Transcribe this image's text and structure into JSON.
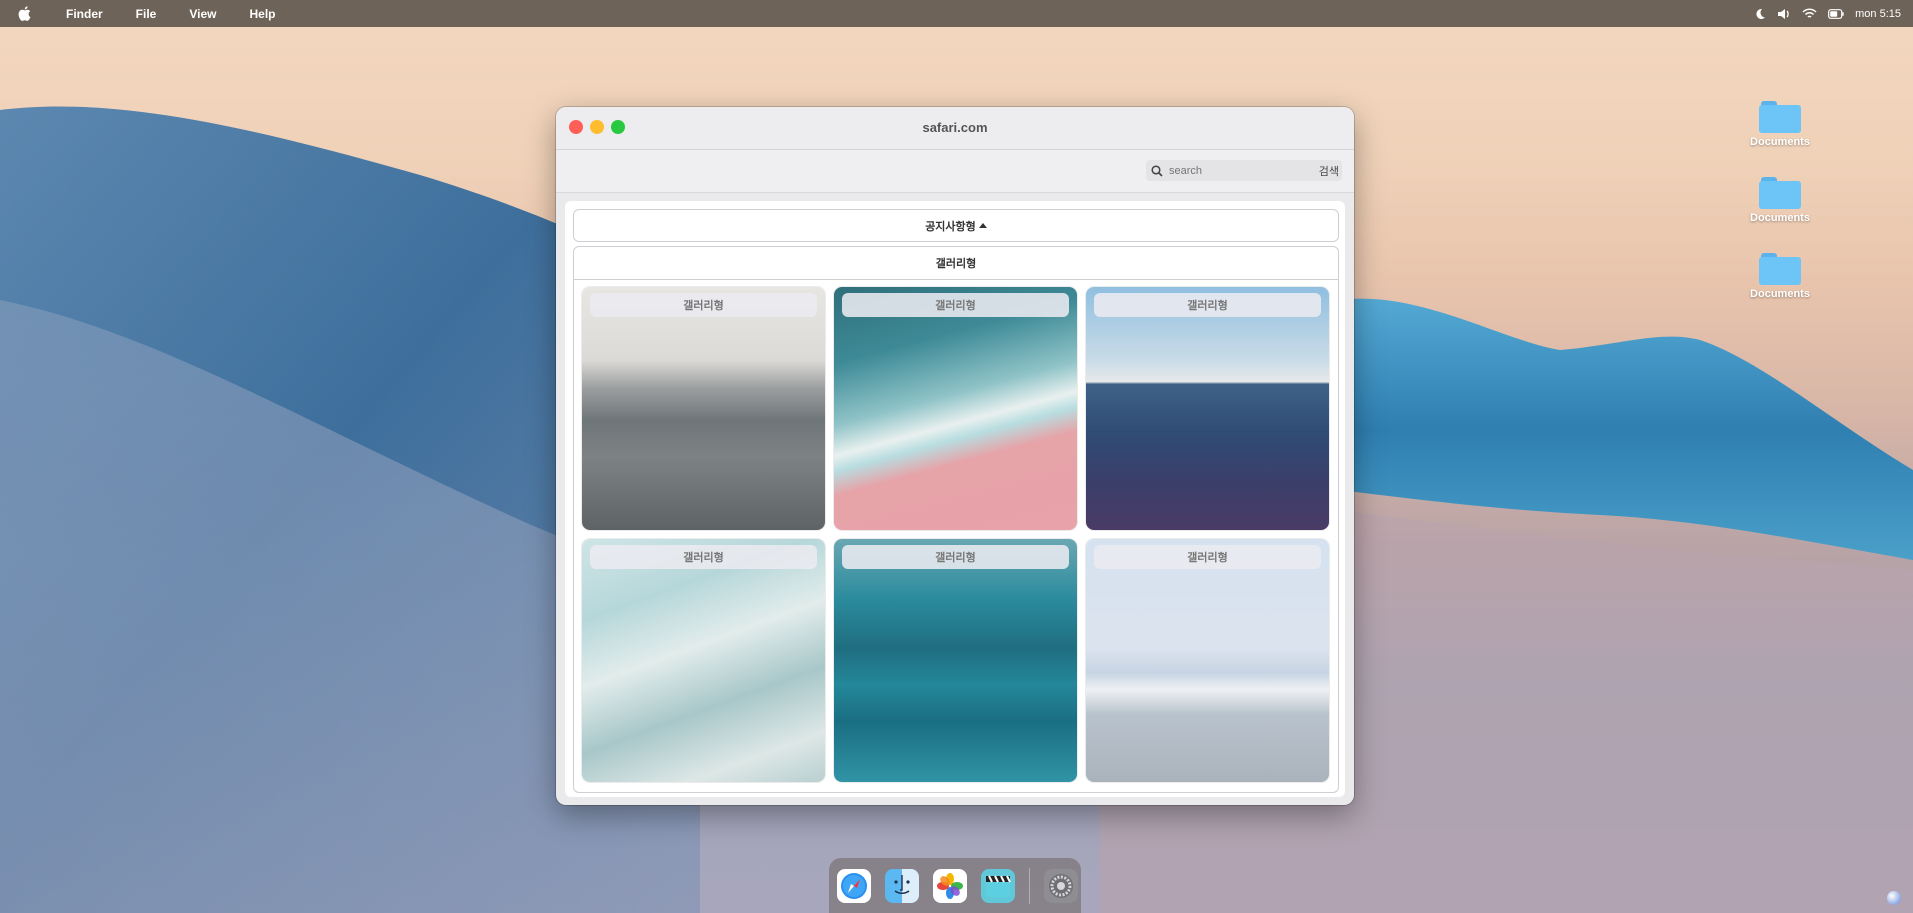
{
  "menubar": {
    "app": "Finder",
    "items": [
      "File",
      "View",
      "Help"
    ],
    "clock": "mon 5:15"
  },
  "desktop": {
    "icons": [
      {
        "label": "Documents",
        "icon": "folder-icon"
      },
      {
        "label": "Documents",
        "icon": "folder-icon"
      },
      {
        "label": "Documents",
        "icon": "folder-icon"
      }
    ]
  },
  "window": {
    "title": "safari.com",
    "search": {
      "placeholder": "search",
      "value": "",
      "button": "검색"
    },
    "notice_toggle": "공지사항형",
    "gallery": {
      "header": "갤러리형",
      "items": [
        {
          "label": "갤러리형",
          "image": "grey-sea-horizon"
        },
        {
          "label": "갤러리형",
          "image": "wave-on-pink-beach"
        },
        {
          "label": "갤러리형",
          "image": "deep-blue-sea-horizon"
        },
        {
          "label": "갤러리형",
          "image": "white-foam-water"
        },
        {
          "label": "갤러리형",
          "image": "teal-ocean-waves"
        },
        {
          "label": "갤러리형",
          "image": "misty-beach-shore"
        }
      ]
    }
  },
  "dock": {
    "apps": [
      "safari-icon",
      "finder-icon",
      "photos-icon",
      "clips-icon",
      "system-settings-icon"
    ]
  },
  "colors": {
    "menubar": "#6e6358",
    "folder": "#6cc4f7",
    "close": "#fe5f57",
    "minimize": "#febc2e",
    "maximize": "#28c840"
  }
}
